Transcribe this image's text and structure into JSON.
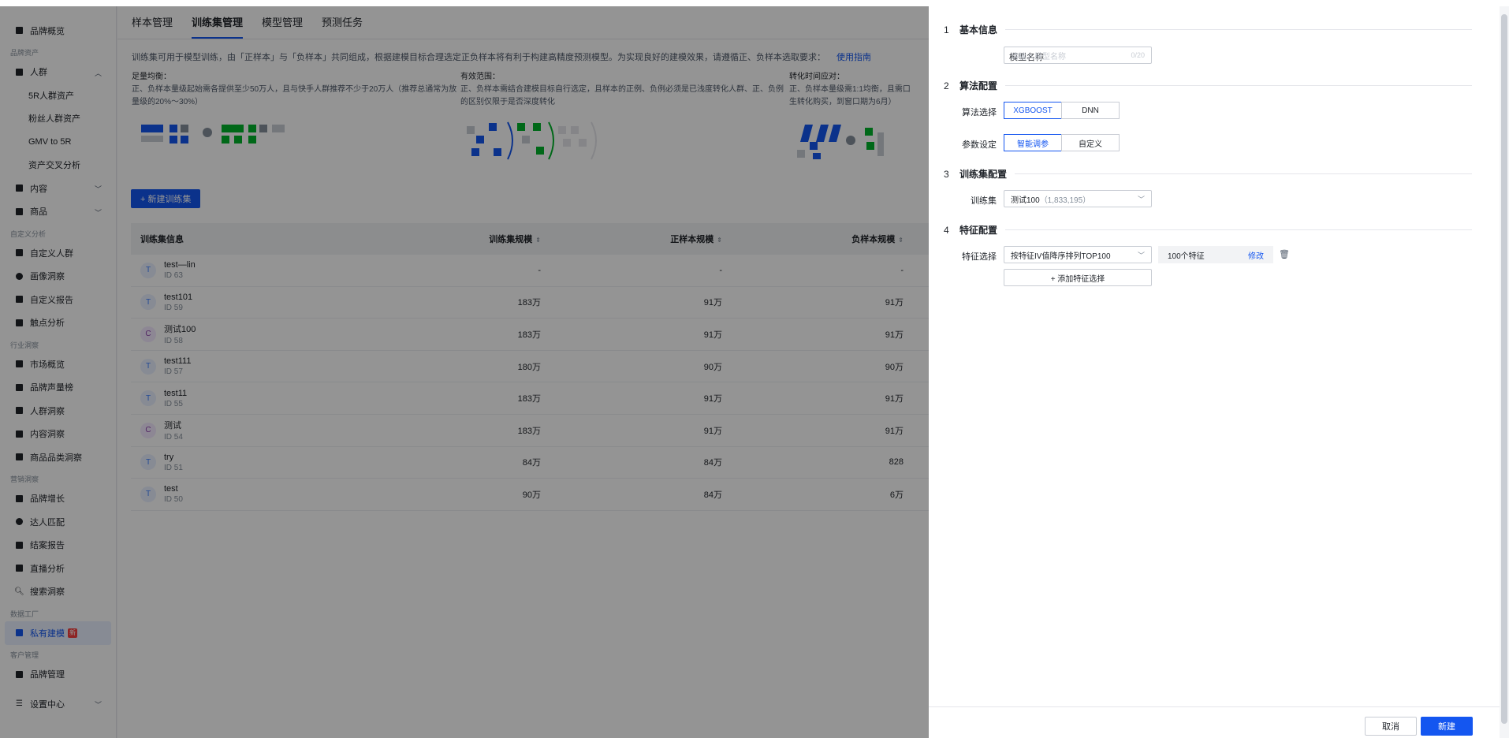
{
  "sidebar": {
    "top": {
      "label": "品牌概览"
    },
    "group_assets": "品牌资产",
    "people": {
      "label": "人群",
      "subs": [
        "5R人群资产",
        "粉丝人群资产",
        "GMV to 5R",
        "资产交叉分析"
      ]
    },
    "content": "内容",
    "goods": "商品",
    "group_custom": "自定义分析",
    "custom_items": [
      "自定义人群",
      "画像洞察",
      "自定义报告",
      "触点分析"
    ],
    "group_industry": "行业洞察",
    "industry_items": [
      "市场概览",
      "品牌声量榜",
      "人群洞察",
      "内容洞察",
      "商品品类洞察"
    ],
    "group_marketing": "营销洞察",
    "marketing_items": [
      "品牌增长",
      "达人匹配",
      "结案报告",
      "直播分析",
      "搜索洞察"
    ],
    "group_factory": "数据工厂",
    "factory_item": "私有建模",
    "new_badge": "新",
    "group_client": "客户管理",
    "client_item": "品牌管理",
    "settings": "设置中心"
  },
  "main": {
    "tabs": [
      "样本管理",
      "训练集管理",
      "模型管理",
      "预测任务"
    ],
    "description": "训练集可用于模型训练，由「正样本」与「负样本」共同组成，根据建模目标合理选定正负样本将有利于构建高精度预测模型。为实现良好的建模效果，请遵循正、负样本选取要求：",
    "guide_link": "使用指南",
    "tips": [
      {
        "title": "足量均衡：",
        "text": "正、负样本量级起始需各提供至少50万人，且与快手人群推荐不少于20万人（推荐总通常为放量级的20%～30%）"
      },
      {
        "title": "有效范围：",
        "text": "正、负样本需结合建模目标自行选定，且样本的正例、负例必须是已浅度转化人群、正、负例的区别仅限于是否深度转化"
      },
      {
        "title": "转化时间应对：",
        "text": "正、负样本量级需1:1均衡，且需口生转化购买，到窗口期为6月）"
      }
    ],
    "new_button": "+ 新建训练集",
    "table": {
      "headers": [
        "训练集信息",
        "训练集规模",
        "正样本规模",
        "负样本规模"
      ],
      "rows": [
        {
          "avatar": "T",
          "name": "test—lin",
          "id": "ID 63",
          "size": "-",
          "pos": "-",
          "neg": "-"
        },
        {
          "avatar": "T",
          "name": "test101",
          "id": "ID 59",
          "size": "183万",
          "pos": "91万",
          "neg": "91万"
        },
        {
          "avatar": "C",
          "name": "测试100",
          "id": "ID 58",
          "size": "183万",
          "pos": "91万",
          "neg": "91万"
        },
        {
          "avatar": "T",
          "name": "test111",
          "id": "ID 57",
          "size": "180万",
          "pos": "90万",
          "neg": "90万"
        },
        {
          "avatar": "T",
          "name": "test11",
          "id": "ID 55",
          "size": "183万",
          "pos": "91万",
          "neg": "91万"
        },
        {
          "avatar": "C",
          "name": "测试",
          "id": "ID 54",
          "size": "183万",
          "pos": "91万",
          "neg": "91万"
        },
        {
          "avatar": "T",
          "name": "try",
          "id": "ID 51",
          "size": "84万",
          "pos": "84万",
          "neg": "828"
        },
        {
          "avatar": "T",
          "name": "test",
          "id": "ID 50",
          "size": "90万",
          "pos": "84万",
          "neg": "6万"
        }
      ]
    }
  },
  "drawer": {
    "sections": [
      {
        "num": "1",
        "title": "基本信息"
      },
      {
        "num": "2",
        "title": "算法配置"
      },
      {
        "num": "3",
        "title": "训练集配置"
      },
      {
        "num": "4",
        "title": "特征配置"
      }
    ],
    "model_name_label": "模型名称",
    "model_name_placeholder": "请输入模型名称",
    "model_name_count": "0/20",
    "algo_label": "算法选择",
    "algo_options": [
      "XGBOOST",
      "DNN"
    ],
    "param_label": "参数设定",
    "param_options": [
      "智能调参",
      "自定义"
    ],
    "trainset_label": "训练集",
    "trainset_value": "测试100",
    "trainset_count": "（1,833,195）",
    "feature_label": "特征选择",
    "feature_value": "按特征IV值降序排列TOP100",
    "feature_count": "100个特征",
    "feature_edit": "修改",
    "add_feature": "+ 添加特征选择",
    "cancel": "取消",
    "create": "新建"
  },
  "colors": {
    "accent": "#1456f0",
    "overlay": "rgba(0,0,0,0.42)"
  }
}
